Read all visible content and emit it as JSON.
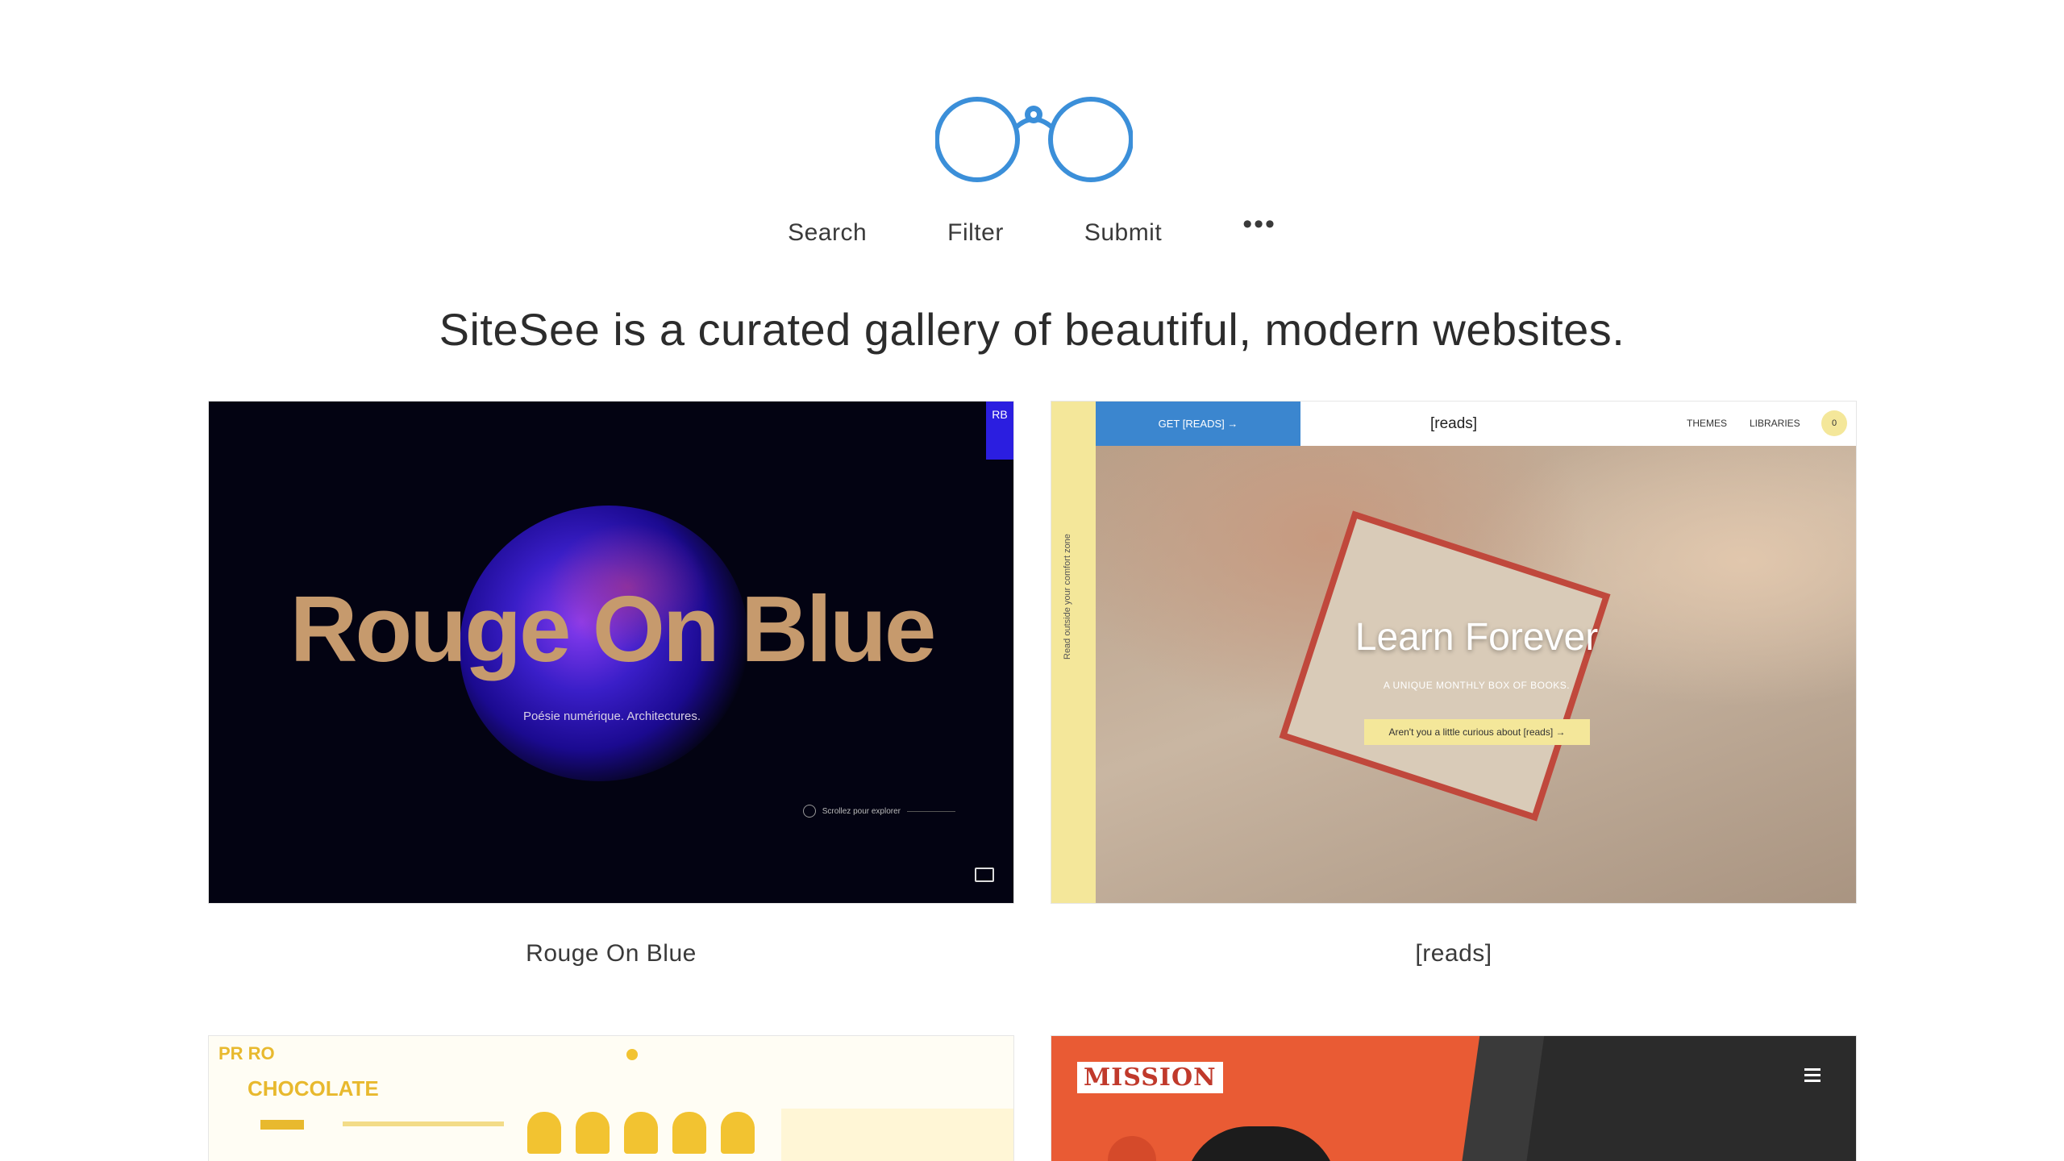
{
  "brand": {
    "logo": "binoculars-icon",
    "accent_color": "#3b8fd9"
  },
  "nav": {
    "search": "Search",
    "filter": "Filter",
    "submit": "Submit",
    "more": "•••"
  },
  "tagline": "SiteSee is a curated gallery of beautiful, modern websites.",
  "gallery": [
    {
      "caption": "Rouge On Blue",
      "preview": {
        "title": "Rouge On Blue",
        "subtitle": "Poésie numérique. Architectures.",
        "scroll_hint": "Scrollez pour explorer",
        "badge": "RB"
      }
    },
    {
      "caption": "[reads]",
      "preview": {
        "get_button": "GET [READS] →",
        "brand": "[reads]",
        "themes": "THEMES",
        "libraries": "LIBRARIES",
        "cart_count": "0",
        "side_text": "Read outside your comfort zone",
        "headline": "Learn Forever",
        "tagline": "A UNIQUE MONTHLY BOX OF BOOKS.",
        "cta": "Aren't you a little curious about [reads] →"
      }
    },
    {
      "caption": "",
      "preview": {
        "logo": "PR RO",
        "title": "CHOCOLATE"
      }
    },
    {
      "caption": "",
      "preview": {
        "label": "MISSION"
      }
    }
  ]
}
